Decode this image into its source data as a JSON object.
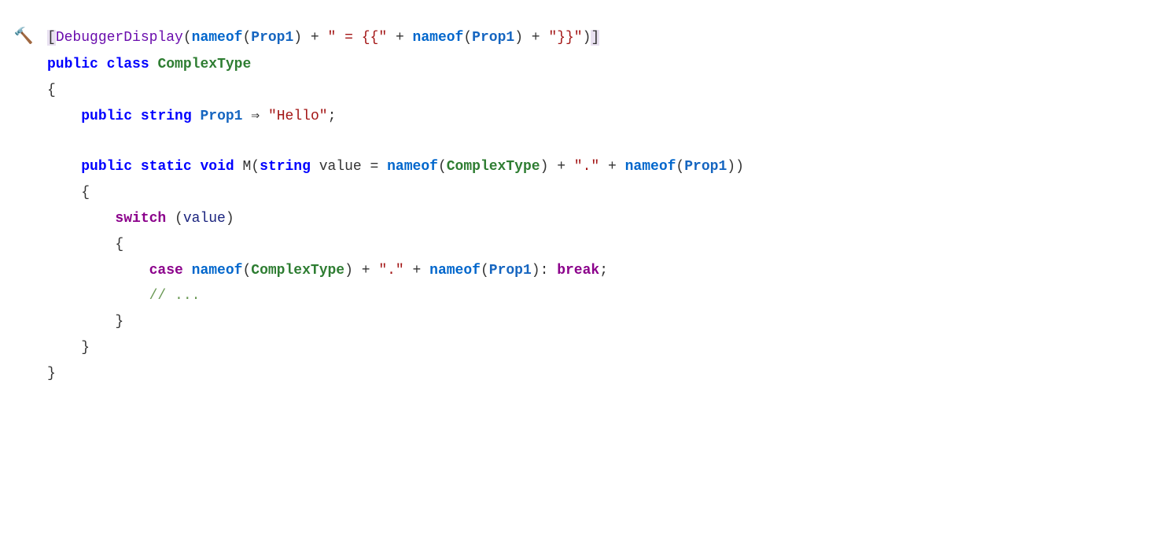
{
  "code": {
    "lines": [
      {
        "gutter": "wrench",
        "indent": "",
        "tokens": [
          {
            "t": "attr-bracket",
            "v": "["
          },
          {
            "t": "attr",
            "v": "DebuggerDisplay"
          },
          {
            "t": "punct",
            "v": "("
          },
          {
            "t": "nameof",
            "v": "nameof"
          },
          {
            "t": "punct",
            "v": "("
          },
          {
            "t": "prop",
            "v": "Prop1"
          },
          {
            "t": "punct",
            "v": ")"
          },
          {
            "t": "plain",
            "v": " + "
          },
          {
            "t": "str",
            "v": "\" = {{\""
          },
          {
            "t": "plain",
            "v": " + "
          },
          {
            "t": "nameof",
            "v": "nameof"
          },
          {
            "t": "punct",
            "v": "("
          },
          {
            "t": "prop",
            "v": "Prop1"
          },
          {
            "t": "punct",
            "v": ")"
          },
          {
            "t": "plain",
            "v": " + "
          },
          {
            "t": "str",
            "v": "\"}}\""
          },
          {
            "t": "punct",
            "v": ")"
          },
          {
            "t": "attr-bracket",
            "v": "]"
          }
        ]
      },
      {
        "gutter": "",
        "indent": "",
        "tokens": [
          {
            "t": "kw",
            "v": "public"
          },
          {
            "t": "plain",
            "v": " "
          },
          {
            "t": "kw",
            "v": "class"
          },
          {
            "t": "plain",
            "v": " "
          },
          {
            "t": "type",
            "v": "ComplexType"
          }
        ]
      },
      {
        "gutter": "",
        "indent": "",
        "tokens": [
          {
            "t": "punct",
            "v": "{"
          }
        ]
      },
      {
        "gutter": "",
        "indent": "    ",
        "tokens": [
          {
            "t": "kw",
            "v": "public"
          },
          {
            "t": "plain",
            "v": " "
          },
          {
            "t": "kw",
            "v": "string"
          },
          {
            "t": "plain",
            "v": " "
          },
          {
            "t": "prop",
            "v": "Prop1"
          },
          {
            "t": "plain",
            "v": " "
          },
          {
            "t": "punct",
            "v": "⇒"
          },
          {
            "t": "plain",
            "v": " "
          },
          {
            "t": "str",
            "v": "\"Hello\""
          },
          {
            "t": "punct",
            "v": ";"
          }
        ]
      },
      {
        "gutter": "",
        "indent": "",
        "tokens": []
      },
      {
        "gutter": "",
        "indent": "    ",
        "tokens": [
          {
            "t": "kw",
            "v": "public"
          },
          {
            "t": "plain",
            "v": " "
          },
          {
            "t": "kw",
            "v": "static"
          },
          {
            "t": "plain",
            "v": " "
          },
          {
            "t": "kw",
            "v": "void"
          },
          {
            "t": "plain",
            "v": " M("
          },
          {
            "t": "kw",
            "v": "string"
          },
          {
            "t": "plain",
            "v": " value = "
          },
          {
            "t": "nameof",
            "v": "nameof"
          },
          {
            "t": "punct",
            "v": "("
          },
          {
            "t": "type",
            "v": "ComplexType"
          },
          {
            "t": "punct",
            "v": ")"
          },
          {
            "t": "plain",
            "v": " + "
          },
          {
            "t": "str",
            "v": "\".\""
          },
          {
            "t": "plain",
            "v": " + "
          },
          {
            "t": "nameof",
            "v": "nameof"
          },
          {
            "t": "punct",
            "v": "("
          },
          {
            "t": "prop",
            "v": "Prop1"
          },
          {
            "t": "punct",
            "v": ")"
          },
          {
            "t": "plain",
            "v": ")"
          }
        ]
      },
      {
        "gutter": "",
        "indent": "    ",
        "tokens": [
          {
            "t": "punct",
            "v": "{"
          }
        ]
      },
      {
        "gutter": "",
        "indent": "        ",
        "tokens": [
          {
            "t": "kw-control",
            "v": "switch"
          },
          {
            "t": "plain",
            "v": " ("
          },
          {
            "t": "value-var",
            "v": "value"
          },
          {
            "t": "plain",
            "v": ")"
          }
        ]
      },
      {
        "gutter": "",
        "indent": "        ",
        "tokens": [
          {
            "t": "punct",
            "v": "{"
          }
        ]
      },
      {
        "gutter": "",
        "indent": "            ",
        "tokens": [
          {
            "t": "kw-control",
            "v": "case"
          },
          {
            "t": "plain",
            "v": " "
          },
          {
            "t": "nameof",
            "v": "nameof"
          },
          {
            "t": "punct",
            "v": "("
          },
          {
            "t": "type",
            "v": "ComplexType"
          },
          {
            "t": "punct",
            "v": ")"
          },
          {
            "t": "plain",
            "v": " + "
          },
          {
            "t": "str",
            "v": "\".\""
          },
          {
            "t": "plain",
            "v": " + "
          },
          {
            "t": "nameof",
            "v": "nameof"
          },
          {
            "t": "punct",
            "v": "("
          },
          {
            "t": "prop",
            "v": "Prop1"
          },
          {
            "t": "punct",
            "v": ")"
          },
          {
            "t": "plain",
            "v": ": "
          },
          {
            "t": "kw-control",
            "v": "break"
          },
          {
            "t": "plain",
            "v": ";"
          }
        ]
      },
      {
        "gutter": "",
        "indent": "            ",
        "tokens": [
          {
            "t": "comment",
            "v": "// ..."
          }
        ]
      },
      {
        "gutter": "",
        "indent": "        ",
        "tokens": [
          {
            "t": "punct",
            "v": "}"
          }
        ]
      },
      {
        "gutter": "",
        "indent": "    ",
        "tokens": [
          {
            "t": "punct",
            "v": "}"
          }
        ]
      },
      {
        "gutter": "",
        "indent": "",
        "tokens": [
          {
            "t": "punct",
            "v": "}"
          }
        ]
      }
    ]
  }
}
